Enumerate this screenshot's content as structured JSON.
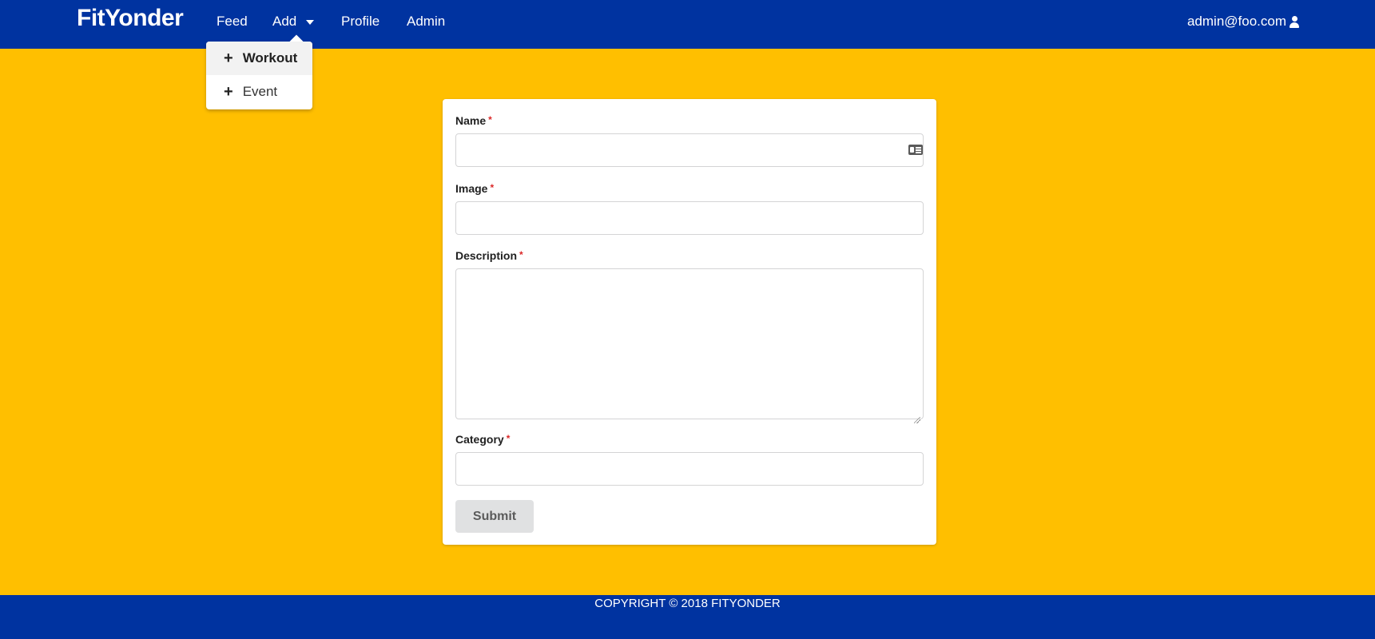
{
  "app": {
    "brand": "FitYonder"
  },
  "nav": {
    "items": [
      {
        "label": "Feed"
      },
      {
        "label": "Add"
      },
      {
        "label": "Profile"
      },
      {
        "label": "Admin"
      }
    ],
    "user_email": "admin@foo.com"
  },
  "add_menu": {
    "items": [
      {
        "label": "Workout",
        "icon": "plus-icon",
        "active": true
      },
      {
        "label": "Event",
        "icon": "plus-icon",
        "active": false
      }
    ]
  },
  "form": {
    "fields": {
      "name": {
        "label": "Name",
        "required_mark": "*",
        "value": "",
        "icon": "id-card-icon"
      },
      "image": {
        "label": "Image",
        "required_mark": "*",
        "value": ""
      },
      "description": {
        "label": "Description",
        "required_mark": "*",
        "value": ""
      },
      "category": {
        "label": "Category",
        "required_mark": "*",
        "value": ""
      }
    },
    "submit_label": "Submit"
  },
  "footer": {
    "copyright": "COPYRIGHT © 2018 FITYONDER"
  },
  "colors": {
    "navbar": "#0033A0",
    "background": "#FFBF00",
    "required": "#DB2828",
    "button": "#E0E1E2"
  }
}
